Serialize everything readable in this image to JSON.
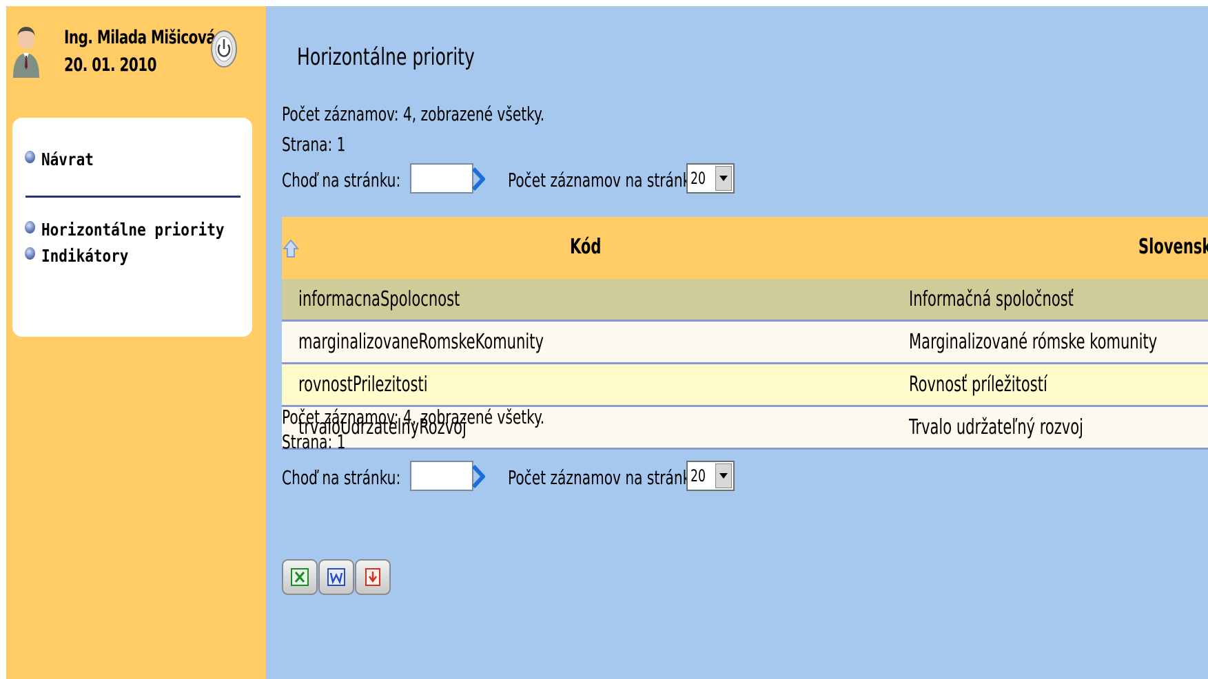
{
  "user": {
    "name": "Ing. Milada Mišicová",
    "date": "20. 01. 2010"
  },
  "nav": {
    "back_label": "Návrat",
    "items": [
      {
        "label": "Horizontálne priority"
      },
      {
        "label": "Indikátory"
      }
    ]
  },
  "page": {
    "title": "Horizontálne priority"
  },
  "pager_top": {
    "count_text": "Počet záznamov: 4, zobrazené všetky.",
    "page_text": "Strana: 1",
    "goto_label": "Choď na stránku:",
    "goto_value": "",
    "per_page_label": "Počet záznamov na stránku:",
    "per_page_value": "20"
  },
  "pager_bottom": {
    "count_text": "Počet záznamov: 4, zobrazené všetky.",
    "page_text": "Strana: 1",
    "goto_label": "Choď na stránku:",
    "goto_value": "",
    "per_page_label": "Počet záznamov na stránku:",
    "per_page_value": "20"
  },
  "table": {
    "headers": {
      "code": "Kód",
      "name": "Slovensky"
    },
    "rows": [
      {
        "code": "informacnaSpolocnost",
        "name": "Informačná spoločnosť"
      },
      {
        "code": "marginalizovaneRomskeKomunity",
        "name": "Marginalizované rómske komunity"
      },
      {
        "code": "rovnostPrilezitosti",
        "name": "Rovnosť príležitostí"
      },
      {
        "code": "trvaloUdrzatelnyRozvoj",
        "name": "Trvalo udržateľný rozvoj"
      }
    ]
  },
  "export": {
    "icons": [
      "excel-icon",
      "word-icon",
      "pdf-icon"
    ]
  },
  "colors": {
    "sidebar_bg": "#ffcc66",
    "main_bg": "#a7c8ee",
    "header_bg": "#ffcc66",
    "row_highlight": "#cfcc99",
    "row_alt": "#fffccc",
    "row_border": "#8b98d6"
  }
}
